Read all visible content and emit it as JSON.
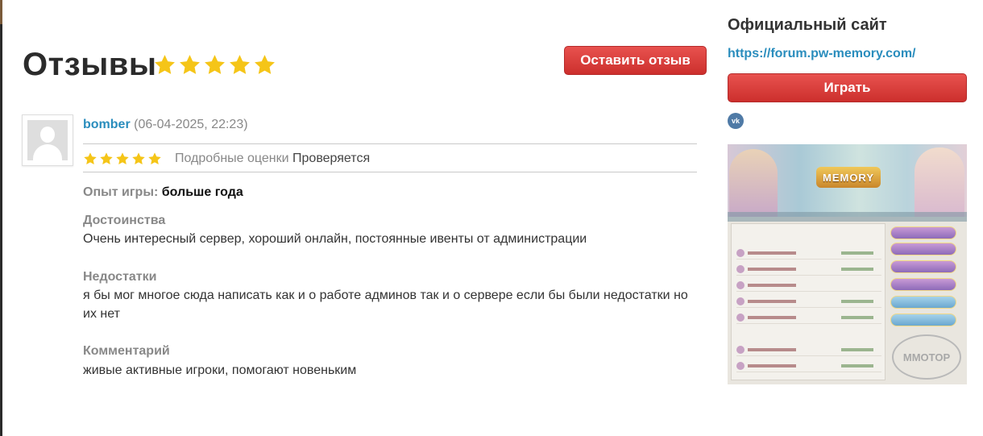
{
  "header": {
    "title": "Отзывы",
    "rating_stars": 5,
    "leave_review_label": "Оставить отзыв"
  },
  "review": {
    "author": "bomber",
    "date": "(06-04-2025, 22:23)",
    "stars": 5,
    "detailed_ratings_label": "Подробные оценки",
    "detailed_ratings_status": "Проверяется",
    "experience_label": "Опыт игры:",
    "experience_value": "больше года",
    "pros_title": "Достоинства",
    "pros_text": "Очень интересный сервер, хороший онлайн, постоянные ивенты от администрации",
    "cons_title": "Недостатки",
    "cons_text": "я бы мог многое сюда написать как и о работе админов так и о сервере если бы были недостатки но их нет",
    "comment_title": "Комментарий",
    "comment_text": "живые активные игроки, помогают новеньким"
  },
  "sidebar": {
    "title": "Официальный сайт",
    "link": "https://forum.pw-memory.com/",
    "play_label": "Играть",
    "social_icon": "vk-icon",
    "screenshot_logo": "MEMORY",
    "watermark": "MMOTOP"
  },
  "colors": {
    "accent_red": "#d63a37",
    "link_blue": "#2a8dbd",
    "star_yellow": "#f5c518"
  }
}
